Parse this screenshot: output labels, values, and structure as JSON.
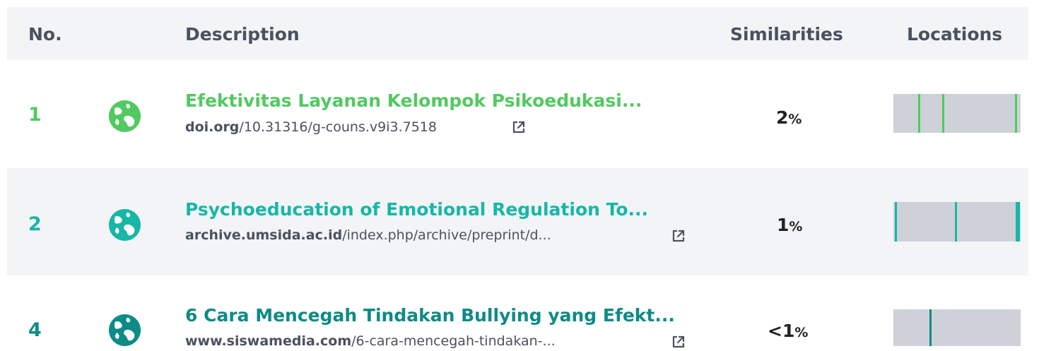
{
  "header": {
    "no": "No.",
    "description": "Description",
    "similarities": "Similarities",
    "locations": "Locations"
  },
  "rows": [
    {
      "no": "1",
      "icon": "globe-icon",
      "color": "#52c961",
      "title": "Efektivitas Layanan Kelompok Psikoedukasi...",
      "url_host": "doi.org",
      "url_path": "/10.31316/g-couns.v9i3.7518",
      "similarity": "2",
      "pct": "%",
      "markers": [
        0.2,
        0.39,
        0.97
      ]
    },
    {
      "no": "2",
      "icon": "globe-icon",
      "color": "#17b7a7",
      "title": "Psychoeducation of Emotional Regulation To...",
      "url_host": "archive.umsida.ac.id",
      "url_path": "/index.php/archive/preprint/d...",
      "similarity": "1",
      "pct": "%",
      "markers": [
        0.01,
        0.49,
        0.98,
        0.995
      ]
    },
    {
      "no": "4",
      "icon": "globe-icon",
      "color": "#0e8b86",
      "title": "6 Cara Mencegah Tindakan Bullying yang Efekt...",
      "url_host": "www.siswamedia.com",
      "url_path": "/6-cara-mencegah-tindakan-...",
      "similarity": "<1",
      "pct": "%",
      "markers": [
        0.29
      ]
    }
  ]
}
